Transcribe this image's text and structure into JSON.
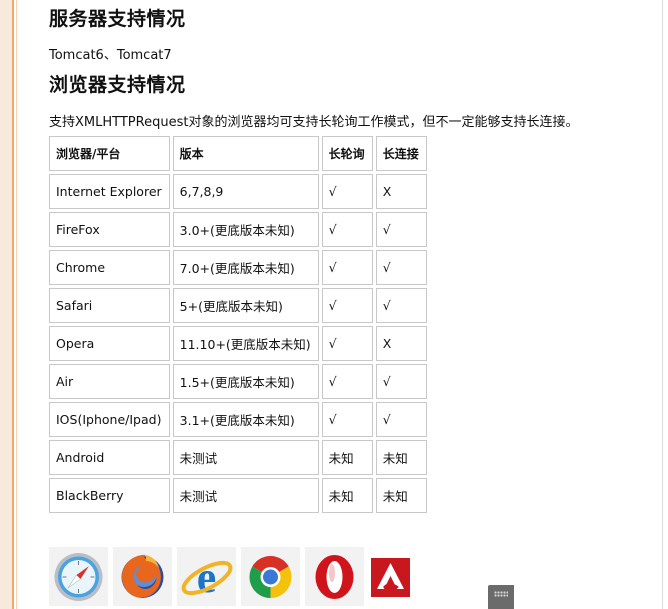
{
  "server_section": {
    "heading": "服务器支持情况",
    "text": "Tomcat6、Tomcat7"
  },
  "browser_section": {
    "heading": "浏览器支持情况",
    "text": "支持XMLHTTPRequest对象的浏览器均可支持长轮询工作模式，但不一定能够支持长连接。"
  },
  "table": {
    "headers": [
      "浏览器/平台",
      "版本",
      "长轮询",
      "长连接"
    ],
    "rows": [
      [
        "Internet Explorer",
        "6,7,8,9",
        "√",
        "X"
      ],
      [
        "FireFox",
        "3.0+(更底版本未知)",
        "√",
        "√"
      ],
      [
        "Chrome",
        "7.0+(更底版本未知)",
        "√",
        "√"
      ],
      [
        "Safari",
        "5+(更底版本未知)",
        "√",
        "√"
      ],
      [
        "Opera",
        "11.10+(更底版本未知)",
        "√",
        "X"
      ],
      [
        "Air",
        "1.5+(更底版本未知)",
        "√",
        "√"
      ],
      [
        "IOS(Iphone/Ipad)",
        "3.1+(更底版本未知)",
        "√",
        "√"
      ],
      [
        "Android",
        "未测试",
        "未知",
        "未知"
      ],
      [
        "BlackBerry",
        "未测试",
        "未知",
        "未知"
      ]
    ]
  },
  "browser_icons": [
    "safari-icon",
    "firefox-icon",
    "internet-explorer-icon",
    "chrome-icon",
    "opera-icon",
    "adobe-air-icon"
  ]
}
